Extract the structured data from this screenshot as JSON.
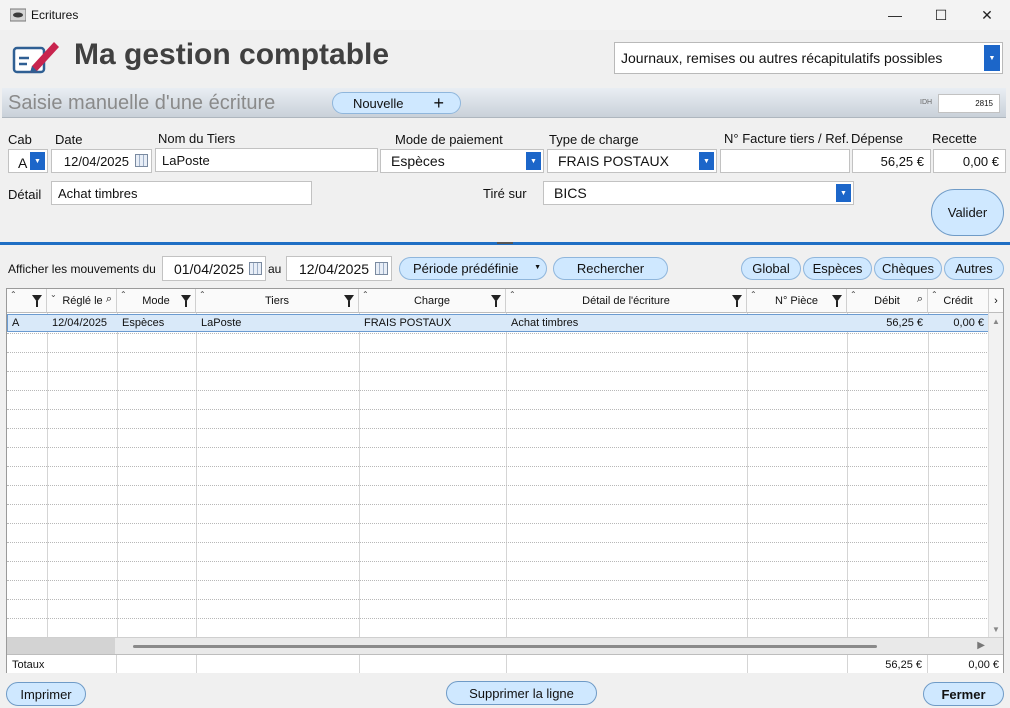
{
  "window": {
    "title": "Ecritures",
    "minimize": "—",
    "maximize": "☐",
    "close": "✕"
  },
  "header": {
    "brand": "Ma gestion comptable",
    "journal_select": "Journaux, remises ou autres récapitulatifs possibles"
  },
  "section": {
    "title": "Saisie manuelle d'une écriture",
    "new_button": "Nouvelle",
    "plus": "+",
    "idh_label": "IDH",
    "idh_value": "2815"
  },
  "form": {
    "labels": {
      "cab": "Cab",
      "date": "Date",
      "tiers": "Nom du Tiers",
      "mode": "Mode de paiement",
      "charge": "Type de charge",
      "facture": "N° Facture tiers / Ref.",
      "depense": "Dépense",
      "recette": "Recette",
      "detail": "Détail",
      "tire_sur": "Tiré sur"
    },
    "values": {
      "cab": "A",
      "date": "12/04/2025",
      "tiers": "LaPoste",
      "mode": "Espèces",
      "charge": "FRAIS POSTAUX",
      "facture": "",
      "depense": "56,25 €",
      "recette": "0,00 €",
      "detail": "Achat timbres",
      "tire_sur": "BICS"
    },
    "validate_button": "Valider"
  },
  "filter": {
    "label_from": "Afficher les mouvements du",
    "date_from": "01/04/2025",
    "label_to": "au",
    "date_to": "12/04/2025",
    "period_button": "Période prédéfinie",
    "search_button": "Rechercher",
    "views": [
      "Global",
      "Espèces",
      "Chèques",
      "Autres"
    ]
  },
  "grid": {
    "columns": [
      "",
      "Réglé le",
      "Mode",
      "Tiers",
      "Charge",
      "Détail de l'écriture",
      "N° Pièce",
      "Débit",
      "Crédit"
    ],
    "rows": [
      [
        "A",
        "12/04/2025",
        "Espèces",
        "LaPoste",
        "FRAIS POSTAUX",
        "Achat timbres",
        "",
        "56,25 €",
        "0,00 €"
      ]
    ],
    "totals_label": "Totaux",
    "total_debit": "56,25 €",
    "total_credit": "0,00 €"
  },
  "footer": {
    "print_button": "Imprimer",
    "delete_button": "Supprimer la ligne",
    "close_button": "Fermer"
  },
  "colors": {
    "accent": "#1c66c9",
    "pill": "#cfe8ff",
    "selected_row": "#d9e9f9"
  }
}
